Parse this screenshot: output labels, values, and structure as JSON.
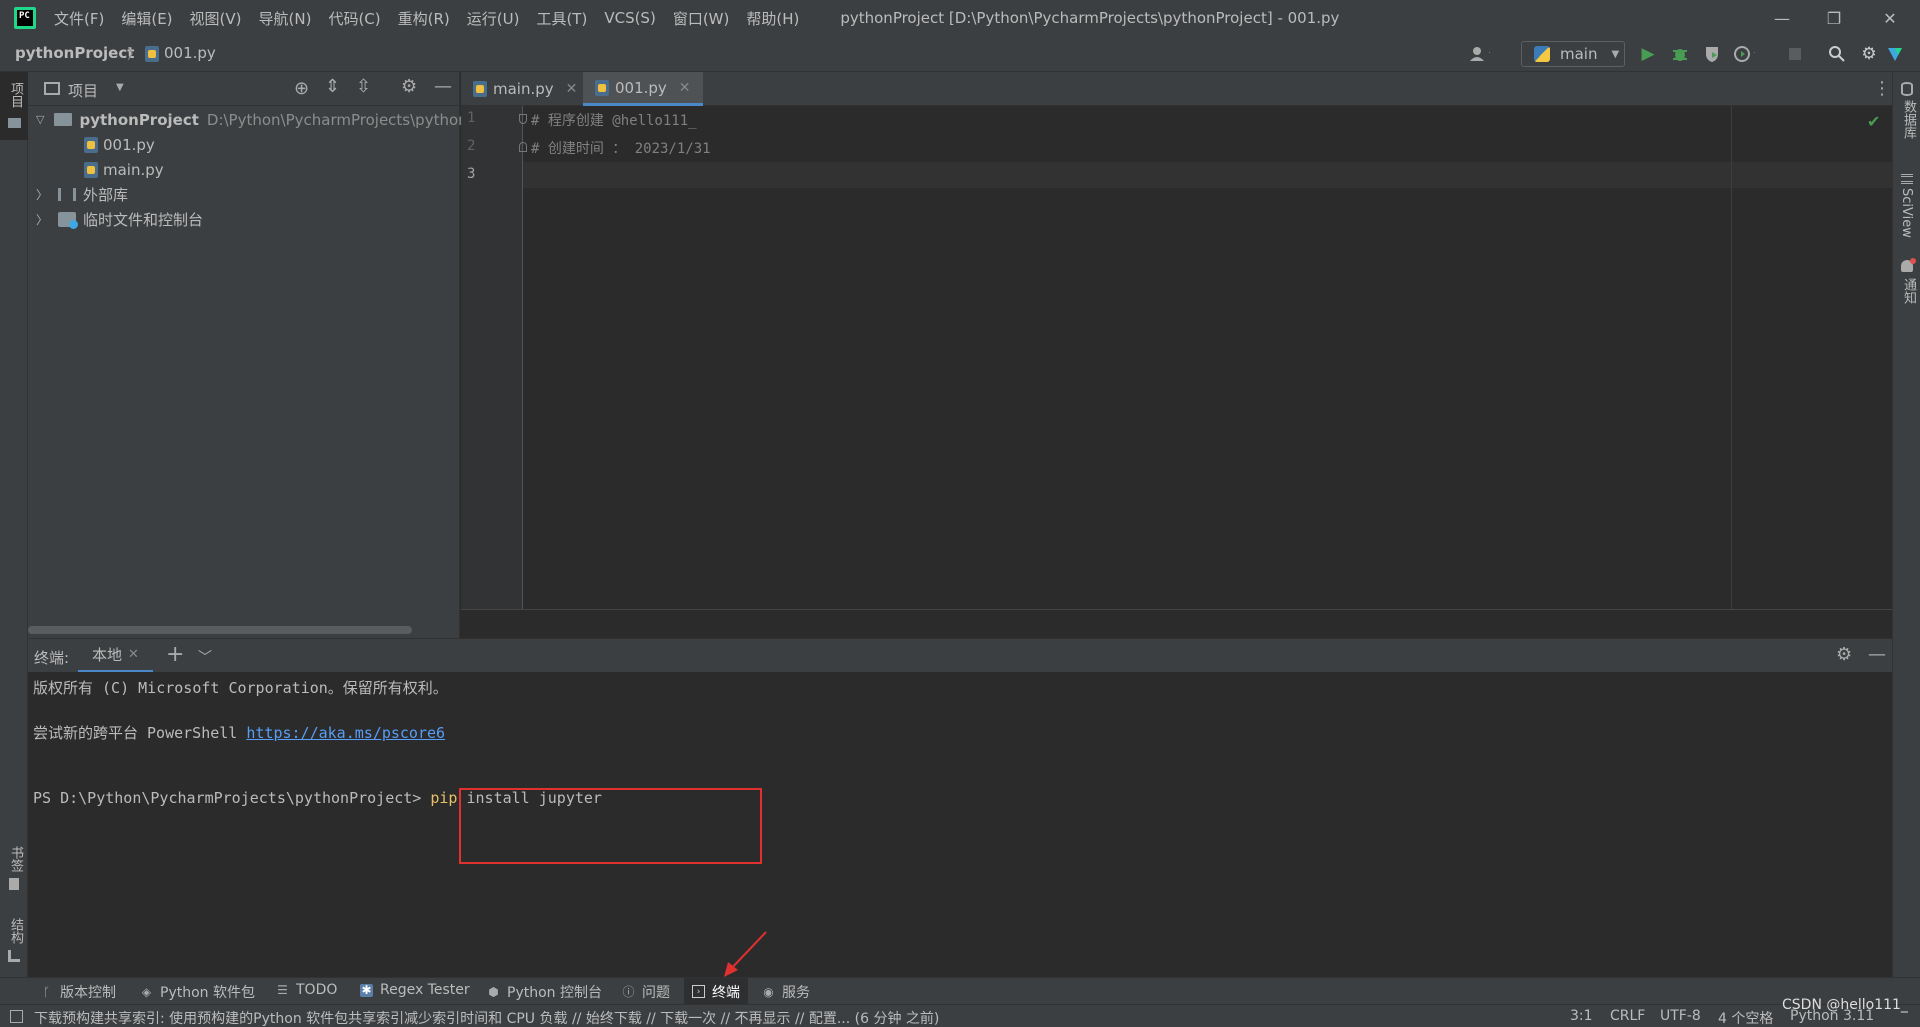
{
  "titlebar": {
    "menus": [
      "文件(F)",
      "编辑(E)",
      "视图(V)",
      "导航(N)",
      "代码(C)",
      "重构(R)",
      "运行(U)",
      "工具(T)",
      "VCS(S)",
      "窗口(W)",
      "帮助(H)"
    ],
    "window_title": "pythonProject [D:\\Python\\PycharmProjects\\pythonProject] - 001.py",
    "minimize": "—",
    "restore": "❐",
    "close": "✕"
  },
  "navbar": {
    "project": "pythonProject",
    "file": "001.py",
    "run_config": "main"
  },
  "left_stripe": {
    "project_tab": "项目",
    "bookmarks_tab": "书签",
    "structure_tab": "结构"
  },
  "right_stripe": {
    "database_tab": "数据库",
    "sciview_tab": "SciView",
    "notifications_tab": "通知"
  },
  "project_panel": {
    "title": "项目",
    "root_name": "pythonProject",
    "root_path": "D:\\Python\\PycharmProjects\\pythonProject",
    "files": [
      "001.py",
      "main.py"
    ],
    "external_libs": "外部库",
    "scratches": "临时文件和控制台"
  },
  "editor": {
    "tabs": [
      "main.py",
      "001.py"
    ],
    "active_tab": "001.py",
    "line_numbers": [
      "1",
      "2",
      "3"
    ],
    "lines": [
      "# 程序创建 @hello111_",
      "# 创建时间 ： 2023/1/31",
      ""
    ]
  },
  "terminal": {
    "label": "终端:",
    "tab": "本地",
    "line1": "版权所有 (C) Microsoft Corporation。保留所有权利。",
    "line2_prefix": "尝试新的跨平台 PowerShell ",
    "line2_link": "https://aka.ms/pscore6",
    "prompt": "PS D:\\Python\\PycharmProjects\\pythonProject> ",
    "cmd_keyword": "pip",
    "cmd_rest": " install jupyter"
  },
  "bottom_tools": [
    "版本控制",
    "Python 软件包",
    "TODO",
    "Regex Tester",
    "Python 控制台",
    "问题",
    "终端",
    "服务"
  ],
  "status": {
    "message": "下载预构建共享索引: 使用预构建的Python 软件包共享索引减少索引时间和 CPU 负载 // 始终下载 // 下载一次 // 不再显示 // 配置... (6 分钟 之前)",
    "position": "3:1",
    "line_sep": "CRLF",
    "encoding": "UTF-8",
    "indent": "4 个空格",
    "interpreter": "Python 3.11",
    "watermark": "CSDN @hello111_"
  },
  "colors": {
    "accent_green": "#499c54",
    "highlight_red": "#e03030",
    "keyword_yellow": "#e8bf6a",
    "link_blue": "#589df6"
  }
}
